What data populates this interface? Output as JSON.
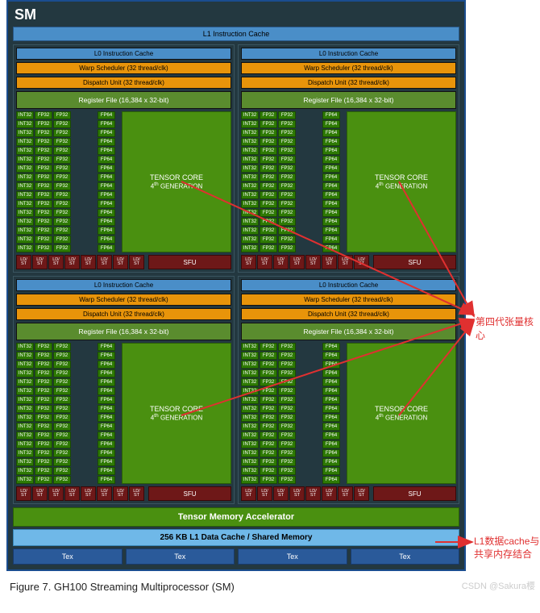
{
  "sm_title": "SM",
  "l1_instruction_cache": "L1 Instruction Cache",
  "quadrant": {
    "l0_instruction_cache": "L0 Instruction Cache",
    "warp_scheduler": "Warp Scheduler (32 thread/clk)",
    "dispatch_unit": "Dispatch Unit (32 thread/clk)",
    "register_file": "Register File (16,384 x 32-bit)",
    "unit_labels": {
      "int32": "INT32",
      "fp32": "FP32",
      "fp64": "FP64"
    },
    "tensor_core": {
      "title": "TENSOR CORE",
      "subtitle": "4th GENERATION"
    },
    "ldst": "LD/ ST",
    "sfu": "SFU"
  },
  "tma": "Tensor Memory Accelerator",
  "l1_data_cache": "256 KB L1 Data Cache / Shared Memory",
  "tex": "Tex",
  "figure_caption": "Figure 7.     GH100 Streaming Multiprocessor (SM)",
  "annotations": {
    "tensor_core_label": "第四代张量核心",
    "l1d_label": "L1数据cache与共享内存结合"
  },
  "watermark": "CSDN @Sakura樱",
  "chart_data": {
    "type": "diagram",
    "architecture": "NVIDIA GH100 Streaming Multiprocessor (SM)",
    "top_level_units": [
      "L1 Instruction Cache",
      "4 × Processing Partitions (quadrants)",
      "Tensor Memory Accelerator",
      "256 KB L1 Data Cache / Shared Memory",
      "4 × Tex units"
    ],
    "per_partition": {
      "L0 Instruction Cache": 1,
      "Warp Scheduler (32 thread/clk)": 1,
      "Dispatch Unit (32 thread/clk)": 1,
      "Register File (16,384 × 32-bit)": 1,
      "INT32 cores": 16,
      "FP32 cores": 32,
      "FP64 cores": 16,
      "Tensor Core (4th Generation)": 1,
      "LD/ST units": 8,
      "SFU": 1
    },
    "sm_totals": {
      "Processing Partitions": 4,
      "INT32 cores": 64,
      "FP32 cores": 128,
      "FP64 cores": 64,
      "Tensor Cores (4th Gen)": 4,
      "LD/ST units": 32,
      "SFU": 4,
      "Tex units": 4,
      "L1 Data Cache / Shared Memory (KB)": 256
    },
    "annotations_cn": {
      "第四代张量核心": "points to all 4 Tensor Cores",
      "L1数据cache与共享内存结合": "points to 256KB L1 Data Cache / Shared Memory bar"
    }
  }
}
